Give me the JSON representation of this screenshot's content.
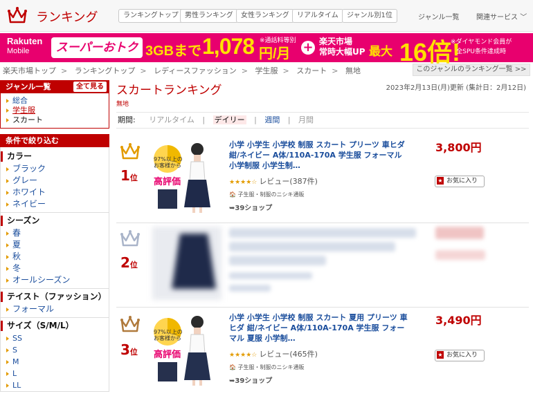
{
  "header": {
    "title": "ランキング",
    "nav": [
      "ランキングトップ",
      "男性ランキング",
      "女性ランキング",
      "リアルタイム",
      "ジャンル別1位"
    ],
    "genre_list": "ジャンル一覧",
    "related": "関連サービス"
  },
  "banner": {
    "brand": "Rakuten",
    "brand_sub": "Mobile",
    "super": "スーパーおトク",
    "plan": "3GBまで",
    "price": "1,078",
    "note": "※通話料等別",
    "unit": "円/月",
    "plus": "+",
    "rt1": "楽天市場",
    "rt2": "常時大幅UP",
    "max": "最大",
    "times": "16倍!",
    "dia1": "※ダイヤモンド会員が",
    "dia2": "全SPU条件達成時"
  },
  "breadcrumb": [
    "楽天市場トップ",
    "ランキングトップ",
    "レディースファッション",
    "学生服",
    "スカート",
    "無地"
  ],
  "genre_ranking_btn": "このジャンルのランキング一覧 >>",
  "sidebar": {
    "genre_header": "ジャンル一覧",
    "show_all": "全て見る",
    "genres": [
      "総合",
      "学生服",
      "スカート"
    ],
    "filter_header": "条件で絞り込む",
    "groups": [
      {
        "title": "カラー",
        "items": [
          "ブラック",
          "グレー",
          "ホワイト",
          "ネイビー"
        ]
      },
      {
        "title": "シーズン",
        "items": [
          "春",
          "夏",
          "秋",
          "冬",
          "オールシーズン"
        ]
      },
      {
        "title": "テイスト（ファッション）",
        "items": [
          "フォーマル"
        ]
      },
      {
        "title": "サイズ（S/M/L）",
        "items": [
          "SS",
          "S",
          "M",
          "L",
          "LL"
        ]
      }
    ]
  },
  "main": {
    "title": "スカートランキング",
    "subtitle": "無地",
    "updated": "2023年2月13日(月)更新 (集計日：2月12日)",
    "period_label": "期間:",
    "periods": [
      "リアルタイム",
      "デイリー",
      "週間",
      "月間"
    ],
    "items": [
      {
        "rank": "1",
        "rank_suffix": "位",
        "title": "小学 小学生 小学校 制服 スカート プリーツ 車ヒダ 紺/ネイビー A体/110A-170A 学生服 フォーマル 小学制服 小学生制…",
        "review": "レビュー(387件)",
        "shop_name": "子生服・制服のニシキ通販",
        "shop": "39ショップ",
        "price": "3,800円",
        "fav": "お気に入り",
        "badge1": "97%以上の",
        "badge2": "お客様から",
        "badge3": "高評価"
      },
      {
        "rank": "2",
        "rank_suffix": "位"
      },
      {
        "rank": "3",
        "rank_suffix": "位",
        "title": "小学 小学生 小学校 制服 スカート 夏用 プリーツ 車ヒダ 紺/ネイビー A体/110A-170A 学生服 フォーマル 夏服 小学制…",
        "review": "レビュー(465件)",
        "shop_name": "子生服・制服のニシキ通販",
        "shop": "39ショップ",
        "price": "3,490円",
        "fav": "お気に入り",
        "badge1": "97%以上の",
        "badge2": "お客様から",
        "badge3": "高評価"
      }
    ]
  },
  "colors": {
    "brand_red": "#bf0000",
    "banner_pink": "#e8006e",
    "gold": "#e39b00",
    "silver": "#a9b4c9",
    "bronze": "#b07a3c"
  }
}
